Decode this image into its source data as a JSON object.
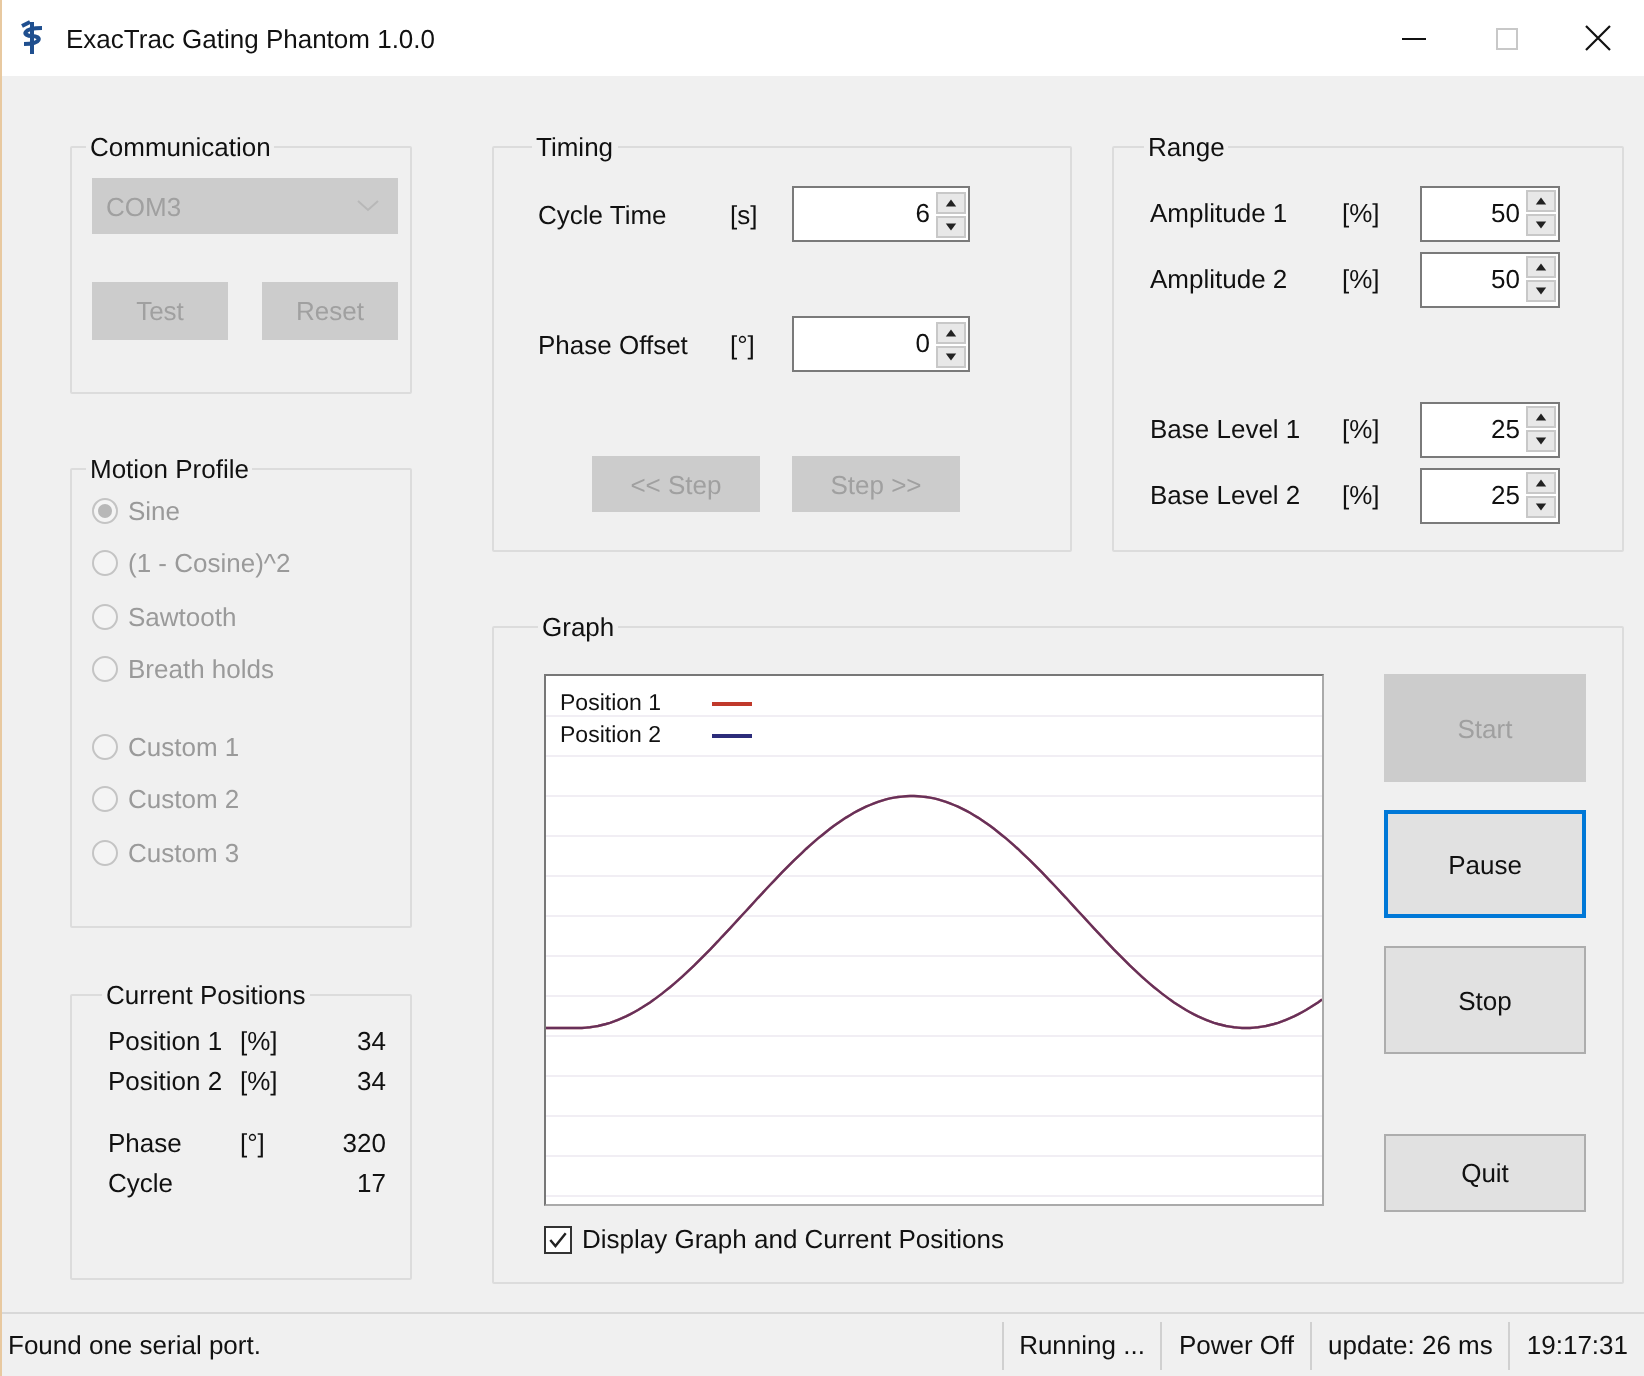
{
  "window": {
    "title": "ExacTrac Gating Phantom 1.0.0"
  },
  "communication": {
    "title": "Communication",
    "port": {
      "value": "COM3",
      "disabled": true
    },
    "buttons": [
      {
        "label": "Test",
        "disabled": true
      },
      {
        "label": "Reset",
        "disabled": true
      }
    ]
  },
  "motion_profile": {
    "title": "Motion Profile",
    "disabled": true,
    "option_groups": [
      [
        {
          "label": "Sine",
          "selected": true
        },
        {
          "label": "(1 - Cosine)^2",
          "selected": false
        },
        {
          "label": "Sawtooth",
          "selected": false
        },
        {
          "label": "Breath holds",
          "selected": false
        }
      ],
      [
        {
          "label": "Custom 1",
          "selected": false
        },
        {
          "label": "Custom 2",
          "selected": false
        },
        {
          "label": "Custom 3",
          "selected": false
        }
      ]
    ]
  },
  "current_positions": {
    "title": "Current Positions",
    "row_groups": [
      [
        {
          "label": "Position 1",
          "unit": "[%]",
          "value": "34"
        },
        {
          "label": "Position 2",
          "unit": "[%]",
          "value": "34"
        }
      ],
      [
        {
          "label": "Phase",
          "unit": "[°]",
          "value": "320"
        },
        {
          "label": "Cycle",
          "value": "17"
        }
      ]
    ]
  },
  "timing": {
    "title": "Timing",
    "fields": [
      {
        "label": "Cycle Time",
        "unit": "[s]",
        "value": "6"
      },
      {
        "label": "Phase Offset",
        "unit": "[°]",
        "value": "0"
      }
    ],
    "buttons": [
      {
        "label": "<< Step",
        "disabled": true
      },
      {
        "label": "Step >>",
        "disabled": true
      }
    ]
  },
  "range": {
    "title": "Range",
    "field_groups": [
      [
        {
          "label": "Amplitude 1",
          "unit": "[%]",
          "value": "50"
        },
        {
          "label": "Amplitude 2",
          "unit": "[%]",
          "value": "50"
        }
      ],
      [
        {
          "label": "Base Level 1",
          "unit": "[%]",
          "value": "25"
        },
        {
          "label": "Base Level 2",
          "unit": "[%]",
          "value": "25"
        }
      ]
    ]
  },
  "graph": {
    "title": "Graph",
    "legend": [
      {
        "label": "Position 1",
        "color": "#c0392b"
      },
      {
        "label": "Position 2",
        "color": "#2c2c7a"
      }
    ],
    "display_option": {
      "label": "Display Graph and Current Positions",
      "checked": true
    },
    "button_groups": [
      [
        {
          "label": "Start",
          "disabled": true,
          "focused": false
        },
        {
          "label": "Pause",
          "disabled": false,
          "focused": true
        },
        {
          "label": "Stop",
          "disabled": false,
          "focused": false
        }
      ],
      [
        {
          "label": "Quit",
          "disabled": false,
          "focused": false
        }
      ]
    ]
  },
  "status_bar": {
    "message": "Found one serial port.",
    "panels": [
      "Running ...",
      "Power Off",
      "update: 26 ms",
      "19:17:31"
    ]
  }
}
